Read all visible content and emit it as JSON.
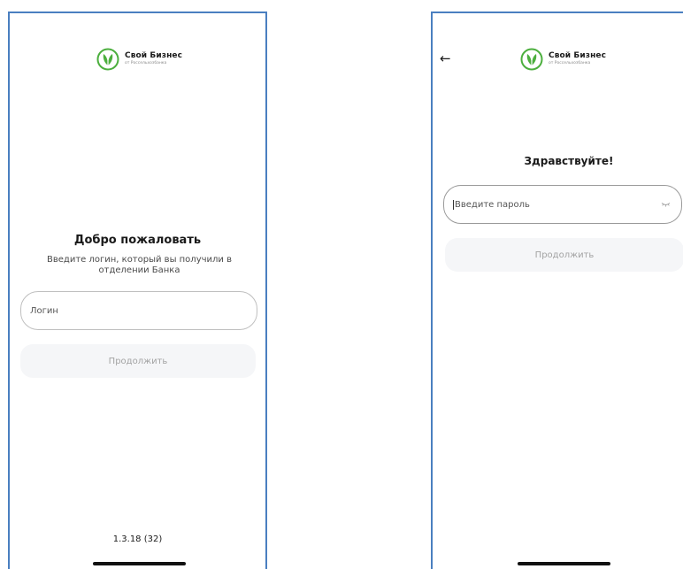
{
  "login_screen": {
    "brand_name": "Свой Бизнес",
    "brand_sub": "от Россельхозбанка",
    "title": "Добро пожаловать",
    "subtitle": "Введите логин, который вы получили в отделении Банка",
    "login_placeholder": "Логин",
    "continue_label": "Продолжить",
    "version": "1.3.18 (32)"
  },
  "password_screen": {
    "back_glyph": "←",
    "brand_name": "Свой Бизнес",
    "brand_sub": "от Россельхозбанка",
    "title": "Здравствуйте!",
    "password_placeholder": "Введите пароль",
    "continue_label": "Продолжить"
  },
  "colors": {
    "brand_green": "#4caf3e",
    "frame_border": "#4a7fc0",
    "button_bg": "#f5f6f8"
  },
  "icons": [
    "bank-logo-icon",
    "back-arrow-icon",
    "eye-closed-icon"
  ]
}
